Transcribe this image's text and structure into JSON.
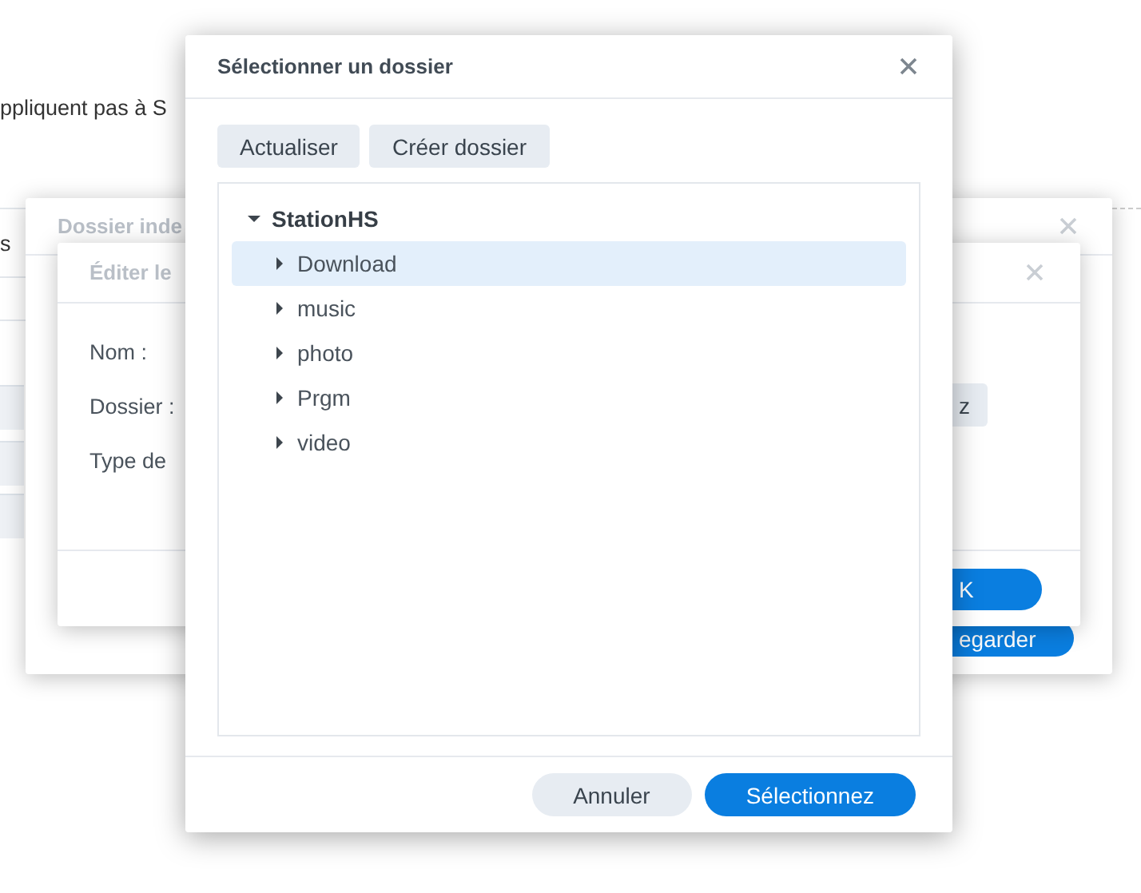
{
  "background_page": {
    "note_text": "ppliquent pas à S",
    "fragment": "s"
  },
  "back_dialog": {
    "title": "Dossier inde",
    "save_button": "egarder"
  },
  "edit_dialog": {
    "title": "Éditer le",
    "fields": [
      {
        "label": "Nom :"
      },
      {
        "label": "Dossier :"
      },
      {
        "label": "Type de"
      }
    ],
    "browse_button": "z",
    "ok_button": "K"
  },
  "folder_dialog": {
    "title": "Sélectionner un dossier",
    "toolbar": [
      "Actualiser",
      "Créer dossier"
    ],
    "tree": {
      "label": "StationHS",
      "expanded": true,
      "children": [
        {
          "label": "Download",
          "selected": true,
          "expanded": false
        },
        {
          "label": "music",
          "selected": false,
          "expanded": false
        },
        {
          "label": "photo",
          "selected": false,
          "expanded": false
        },
        {
          "label": "Prgm",
          "selected": false,
          "expanded": false
        },
        {
          "label": "video",
          "selected": false,
          "expanded": false
        }
      ]
    },
    "buttons": [
      {
        "label": "Annuler",
        "kind": "secondary"
      },
      {
        "label": "Sélectionnez",
        "kind": "primary"
      }
    ]
  }
}
